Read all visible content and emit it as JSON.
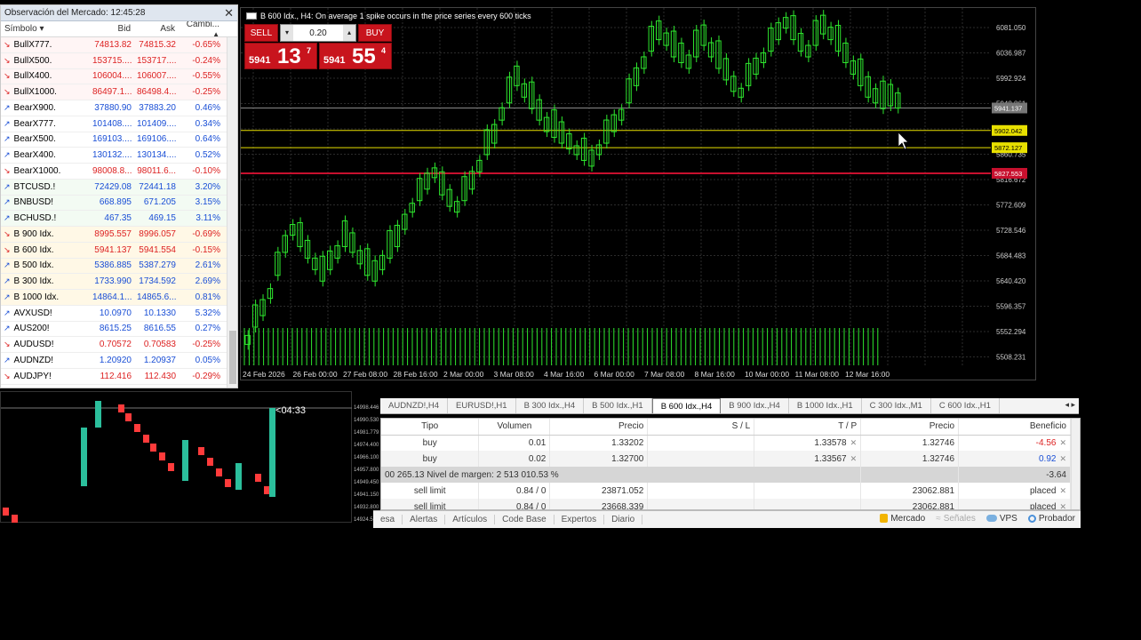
{
  "market_watch": {
    "title": "Observación del Mercado: 12:45:28",
    "columns": [
      "Símbolo",
      "Bid",
      "Ask",
      "Cambi..."
    ],
    "rows": [
      {
        "symbol": "BullX777.",
        "bid": "74813.82",
        "ask": "74815.32",
        "change": "-0.65%",
        "dir": "down"
      },
      {
        "symbol": "BullX500.",
        "bid": "153715....",
        "ask": "153717....",
        "change": "-0.24%",
        "dir": "down"
      },
      {
        "symbol": "BullX400.",
        "bid": "106004....",
        "ask": "106007....",
        "change": "-0.55%",
        "dir": "down"
      },
      {
        "symbol": "BullX1000.",
        "bid": "86497.1...",
        "ask": "86498.4...",
        "change": "-0.25%",
        "dir": "down"
      },
      {
        "symbol": "BearX900.",
        "bid": "37880.90",
        "ask": "37883.20",
        "change": "0.46%",
        "dir": "up"
      },
      {
        "symbol": "BearX777.",
        "bid": "101408....",
        "ask": "101409....",
        "change": "0.34%",
        "dir": "up"
      },
      {
        "symbol": "BearX500.",
        "bid": "169103....",
        "ask": "169106....",
        "change": "0.64%",
        "dir": "up"
      },
      {
        "symbol": "BearX400.",
        "bid": "130132....",
        "ask": "130134....",
        "change": "0.52%",
        "dir": "up"
      },
      {
        "symbol": "BearX1000.",
        "bid": "98008.8...",
        "ask": "98011.6...",
        "change": "-0.10%",
        "dir": "down"
      },
      {
        "symbol": "BTCUSD.!",
        "bid": "72429.08",
        "ask": "72441.18",
        "change": "3.20%",
        "dir": "up"
      },
      {
        "symbol": "BNBUSD!",
        "bid": "668.895",
        "ask": "671.205",
        "change": "3.15%",
        "dir": "up"
      },
      {
        "symbol": "BCHUSD.!",
        "bid": "467.35",
        "ask": "469.15",
        "change": "3.11%",
        "dir": "up"
      },
      {
        "symbol": "B 900 Idx.",
        "bid": "8995.557",
        "ask": "8996.057",
        "change": "-0.69%",
        "dir": "down"
      },
      {
        "symbol": "B 600 Idx.",
        "bid": "5941.137",
        "ask": "5941.554",
        "change": "-0.15%",
        "dir": "down"
      },
      {
        "symbol": "B 500 Idx.",
        "bid": "5386.885",
        "ask": "5387.279",
        "change": "2.61%",
        "dir": "up"
      },
      {
        "symbol": "B 300 Idx.",
        "bid": "1733.990",
        "ask": "1734.592",
        "change": "2.69%",
        "dir": "up"
      },
      {
        "symbol": "B 1000 Idx.",
        "bid": "14864.1...",
        "ask": "14865.6...",
        "change": "0.81%",
        "dir": "up"
      },
      {
        "symbol": "AVXUSD!",
        "bid": "10.0970",
        "ask": "10.1330",
        "change": "5.32%",
        "dir": "up"
      },
      {
        "symbol": "AUS200!",
        "bid": "8615.25",
        "ask": "8616.55",
        "change": "0.27%",
        "dir": "up"
      },
      {
        "symbol": "AUDUSD!",
        "bid": "0.70572",
        "ask": "0.70583",
        "change": "-0.25%",
        "dir": "down"
      },
      {
        "symbol": "AUDNZD!",
        "bid": "1.20920",
        "ask": "1.20937",
        "change": "0.05%",
        "dir": "up"
      },
      {
        "symbol": "AUDJPY!",
        "bid": "112.416",
        "ask": "112.430",
        "change": "-0.29%",
        "dir": "down"
      }
    ]
  },
  "chart": {
    "title": "B 600 Idx., H4:  On average 1 spike occurs in the price series every 600 ticks",
    "one_click": {
      "sell_label": "SELL",
      "buy_label": "BUY",
      "volume": "0.20",
      "bid_small": "5941",
      "bid_big": "13",
      "bid_sup": "7",
      "ask_small": "5941",
      "ask_big": "55",
      "ask_sup": "4"
    },
    "price_axis": [
      "6081.050",
      "6036.987",
      "5992.924",
      "5948.861",
      "5904.798",
      "5860.735",
      "5816.672",
      "5772.609",
      "5728.546",
      "5684.483",
      "5640.420",
      "5596.357",
      "5552.294",
      "5508.231"
    ],
    "highlight_labels": {
      "current": "5941.137",
      "yellow1": "5902.042",
      "yellow2": "5872.127",
      "red": "5827.553"
    },
    "time_axis": [
      "24 Feb 2026",
      "26 Feb 00:00",
      "27 Feb 08:00",
      "28 Feb 16:00",
      "2 Mar 00:00",
      "3 Mar 08:00",
      "4 Mar 16:00",
      "6 Mar 00:00",
      "7 Mar 08:00",
      "8 Mar 16:00",
      "10 Mar 00:00",
      "11 Mar 08:00",
      "12 Mar 16:00"
    ]
  },
  "chart_tabs": {
    "items": [
      "AUDNZD!,H4",
      "EURUSD!,H1",
      "B 300 Idx.,H4",
      "B 500 Idx.,H1",
      "B 600 Idx.,H4",
      "B 900 Idx.,H4",
      "B 1000 Idx.,H1",
      "C 300 Idx.,M1",
      "C 600 Idx.,H1"
    ],
    "active_index": 4
  },
  "mini_chart": {
    "timer": "04:33",
    "axis": [
      "14998.446",
      "14990.530",
      "14981.779",
      "14974.400",
      "14966.100",
      "14957.800",
      "14949.450",
      "14941.150",
      "14932.800",
      "14924.520"
    ]
  },
  "terminal": {
    "columns": [
      "Tipo",
      "Volumen",
      "Precio",
      "S / L",
      "T / P",
      "Precio",
      "Beneficio"
    ],
    "positions": [
      {
        "type": "buy",
        "volume": "0.01",
        "price": "1.33202",
        "sl": "",
        "tp": "1.33578",
        "current": "1.32746",
        "profit": "-4.56",
        "profit_sign": "neg"
      },
      {
        "type": "buy",
        "volume": "0.02",
        "price": "1.32700",
        "sl": "",
        "tp": "1.33567",
        "current": "1.32746",
        "profit": "0.92",
        "profit_sign": "pos"
      }
    ],
    "summary": {
      "text": "00 265.13  Nivel de margen: 2 513 010.53 %",
      "total": "-3.64"
    },
    "orders": [
      {
        "type": "sell limit",
        "volume": "0.84 / 0",
        "price": "23871.052",
        "current": "23062.881",
        "state": "placed"
      },
      {
        "type": "sell limit",
        "volume": "0.84 / 0",
        "price": "23668.339",
        "current": "23062.881",
        "state": "placed"
      }
    ]
  },
  "bottom_bar": {
    "tabs": [
      "esa",
      "Alertas",
      "Artículos",
      "Code Base",
      "Expertos",
      "Diario"
    ],
    "right": {
      "market": "Mercado",
      "signals": "Señales",
      "vps": "VPS",
      "tester": "Probador"
    }
  },
  "colors": {
    "bull": "#2ee82e",
    "red_level": "#c8102e",
    "yellow_level": "#e8e000",
    "one_click_red": "#c8141d",
    "mini_bull": "#2bbf9c",
    "mini_bear": "#ff3b3b"
  }
}
